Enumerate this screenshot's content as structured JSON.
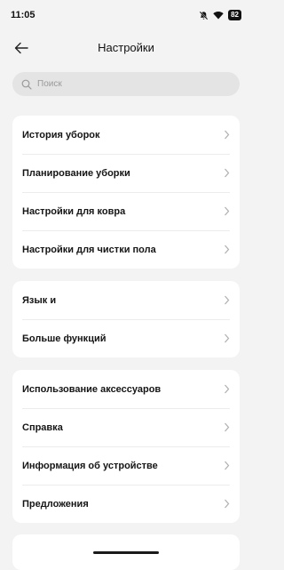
{
  "status_bar": {
    "time": "11:05",
    "battery": "82",
    "icons": [
      "mute-icon",
      "wifi-icon",
      "battery-icon"
    ]
  },
  "header": {
    "title": "Настройки",
    "back_icon": "arrow-left-icon"
  },
  "search": {
    "placeholder": "Поиск",
    "icon": "search-icon"
  },
  "groups": [
    {
      "items": [
        {
          "label": "История уборок"
        },
        {
          "label": "Планирование уборки"
        },
        {
          "label": "Настройки для ковра"
        },
        {
          "label": "Настройки для чистки пола"
        }
      ]
    },
    {
      "items": [
        {
          "label": "Язык и"
        },
        {
          "label": "Больше функций"
        }
      ]
    },
    {
      "items": [
        {
          "label": "Использование аксессуаров"
        },
        {
          "label": "Справка"
        },
        {
          "label": "Информация об устройстве"
        },
        {
          "label": "Предложения"
        }
      ]
    }
  ],
  "colors": {
    "background": "#f3f3f3",
    "card": "#ffffff",
    "search_field": "#e4e4e4",
    "chevron": "#b0b0b0"
  }
}
